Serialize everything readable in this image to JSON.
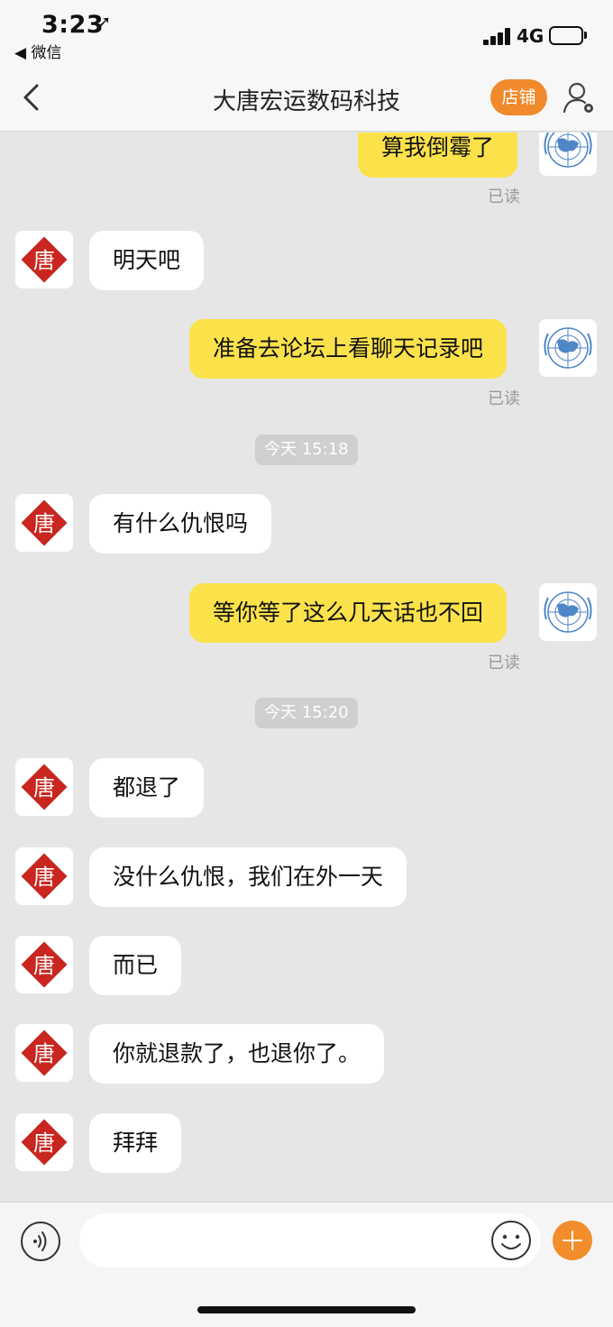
{
  "status_bar": {
    "time": "3:23",
    "back_app": "◀ 微信",
    "network": "4G"
  },
  "nav": {
    "title": "大唐宏运数码科技",
    "store_label": "店铺"
  },
  "messages": [
    {
      "side": "out",
      "text": "算我倒霉了",
      "read": "已读"
    },
    {
      "side": "in",
      "text": "明天吧"
    },
    {
      "side": "out",
      "text": "准备去论坛上看聊天记录吧",
      "read": "已读"
    },
    {
      "type": "time",
      "text": "今天 15:18"
    },
    {
      "side": "in",
      "text": "有什么仇恨吗"
    },
    {
      "side": "out",
      "text": "等你等了这么几天话也不回",
      "read": "已读"
    },
    {
      "type": "time",
      "text": "今天 15:20"
    },
    {
      "side": "in",
      "text": "都退了"
    },
    {
      "side": "in",
      "text": "没什么仇恨，我们在外一天"
    },
    {
      "side": "in",
      "text": "而已"
    },
    {
      "side": "in",
      "text": "你就退款了，也退你了。"
    },
    {
      "side": "in",
      "text": "拜拜"
    }
  ],
  "input": {
    "placeholder": "",
    "value": ""
  },
  "avatars": {
    "shop": "唐",
    "user": "un-emblem-icon"
  },
  "colors": {
    "bubble_out": "#fbe24a",
    "bubble_in": "#ffffff",
    "accent": "#f08a2c",
    "background": "#e6e6e6"
  }
}
